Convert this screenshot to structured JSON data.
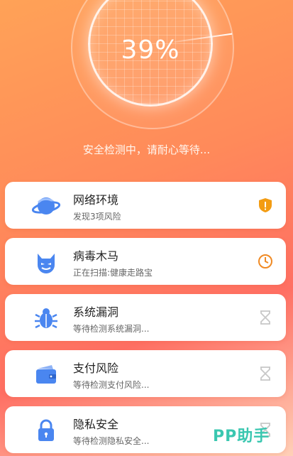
{
  "scan": {
    "percent_label": "39%",
    "progress": 0.39,
    "status_text": "安全检测中，请耐心等待..."
  },
  "items": [
    {
      "title": "网络环境",
      "subtitle": "发现3项风险",
      "icon": "planet-icon",
      "status": "warning-shield-icon",
      "status_color": "#f39c12"
    },
    {
      "title": "病毒木马",
      "subtitle": "正在扫描:健康走路宝",
      "icon": "devil-icon",
      "status": "clock-icon",
      "status_color": "#f08a24"
    },
    {
      "title": "系统漏洞",
      "subtitle": "等待检测系统漏洞...",
      "icon": "bug-icon",
      "status": "hourglass-icon",
      "status_color": "#c8c8c8"
    },
    {
      "title": "支付风险",
      "subtitle": "等待检测支付风险...",
      "icon": "wallet-icon",
      "status": "hourglass-icon",
      "status_color": "#c8c8c8"
    },
    {
      "title": "隐私安全",
      "subtitle": "等待检测隐私安全...",
      "icon": "lock-icon",
      "status": "hourglass-icon",
      "status_color": "#c8c8c8"
    }
  ],
  "watermark": "PP助手",
  "colors": {
    "icon_blue": "#4a86f0",
    "background_start": "#ffa257",
    "background_end": "#ff6f63"
  }
}
